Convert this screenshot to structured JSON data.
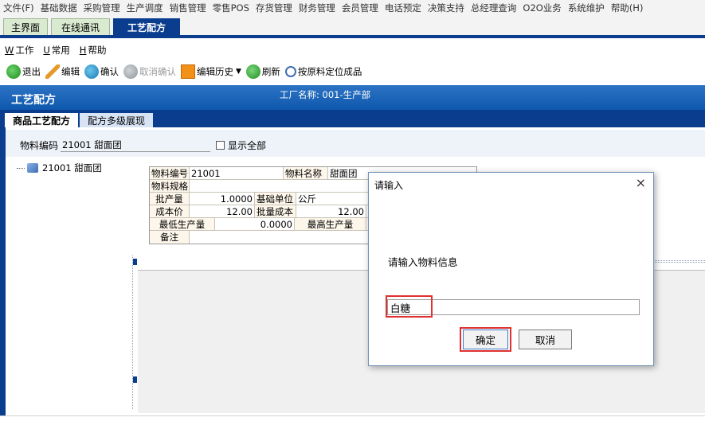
{
  "menubar": [
    "文件(F)",
    "基础数据",
    "采购管理",
    "生产调度",
    "销售管理",
    "零售POS",
    "存货管理",
    "财务管理",
    "会员管理",
    "电话预定",
    "决策支持",
    "总经理查询",
    "O2O业务",
    "系统维护",
    "帮助(H)"
  ],
  "tabs": {
    "main": "主界面",
    "comm": "在线通讯",
    "recipe": "工艺配方"
  },
  "menu2": [
    {
      "key": "W",
      "label": "工作"
    },
    {
      "key": "U",
      "label": "常用"
    },
    {
      "key": "H",
      "label": "帮助"
    }
  ],
  "toolbar": {
    "exit": "退出",
    "edit": "编辑",
    "confirm": "确认",
    "cancel_confirm": "取消确认",
    "edit_history": "编辑历史",
    "refresh": "刷新",
    "locate": "按原料定位成品"
  },
  "titlebar": {
    "title": "工艺配方",
    "factory": "工厂名称: 001-生产部"
  },
  "subtabs": {
    "a": "商品工艺配方",
    "b": "配方多级展现"
  },
  "filter": {
    "label": "物料编码",
    "value": "21001 甜面团",
    "show_all": "显示全部"
  },
  "tree": {
    "node": "21001 甜面团"
  },
  "form": {
    "code_label": "物料编号",
    "code_value": "21001",
    "name_label": "物料名称",
    "name_value": "甜面团",
    "spec_label": "物料规格",
    "spec_value": "",
    "batch_label": "批产量",
    "batch_value": "1.0000",
    "unit_label": "基础单位",
    "unit_value": "公斤",
    "cost_label": "成本价",
    "cost_value": "12.00",
    "batch_cost_label": "批量成本",
    "batch_cost_value": "12.00",
    "min_label": "最低生产量",
    "min_value": "0.0000",
    "max_label": "最高生产量",
    "max_value": "",
    "remark_label": "备注",
    "remark_value": ""
  },
  "dialog": {
    "title": "请输入",
    "close": "×",
    "message": "请输入物料信息",
    "input_value": "白糖",
    "ok": "确定",
    "cancel": "取消"
  },
  "colors": {
    "accent_blue": "#0b3d8f",
    "highlight_red": "#e03030"
  }
}
